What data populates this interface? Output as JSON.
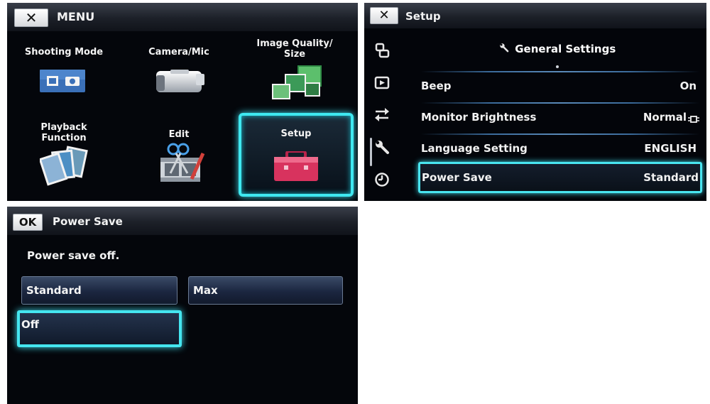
{
  "menu_screen": {
    "close_label": "✕",
    "title": "MENU",
    "tiles": [
      {
        "label": "Shooting Mode",
        "icon": "shooting-mode-icon"
      },
      {
        "label": "Camera/Mic",
        "icon": "camera-mic-icon"
      },
      {
        "label": "Image Quality/\nSize",
        "icon": "image-quality-icon"
      },
      {
        "label": "Playback\nFunction",
        "icon": "playback-function-icon"
      },
      {
        "label": "Edit",
        "icon": "edit-icon"
      },
      {
        "label": "Setup",
        "icon": "toolbox-icon",
        "selected": true
      }
    ]
  },
  "setup_screen": {
    "close_label": "✕",
    "title": "Setup",
    "section_title": "General Settings",
    "side_icons": [
      "display-icon",
      "playback-icon",
      "transfer-icon",
      "wrench-icon",
      "clock-icon"
    ],
    "settings": [
      {
        "label": "Beep",
        "value": "On"
      },
      {
        "label": "Monitor Brightness",
        "value": "Normal"
      },
      {
        "label": "Language Setting",
        "value": "ENGLISH"
      },
      {
        "label": "Power Save",
        "value": "Standard",
        "selected": true
      }
    ]
  },
  "power_save_screen": {
    "ok_label": "OK",
    "title": "Power Save",
    "status": "Power save off.",
    "options": [
      {
        "label": "Standard"
      },
      {
        "label": "Max"
      },
      {
        "label": "Off",
        "selected": true
      }
    ]
  },
  "colors": {
    "highlight": "#45e6f0",
    "background": "#04060b",
    "button_face": "#1b2640"
  }
}
